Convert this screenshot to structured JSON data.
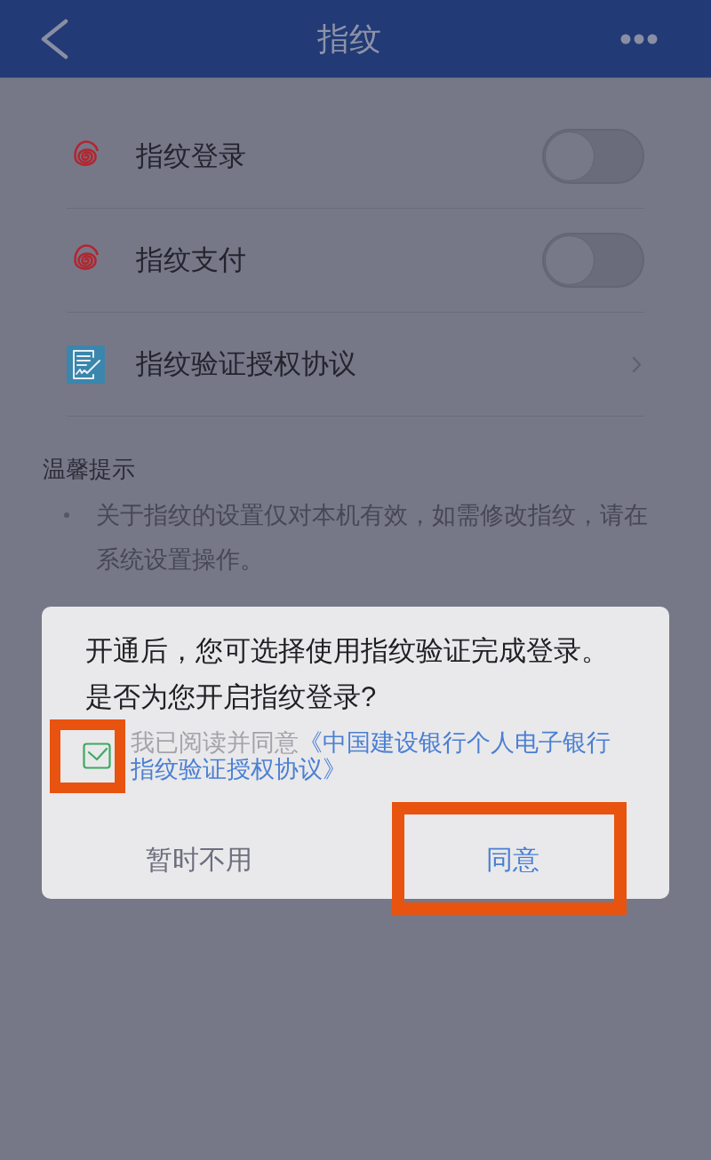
{
  "header": {
    "title": "指纹"
  },
  "settings": [
    {
      "kind": "toggle",
      "label": "指纹登录",
      "on": false
    },
    {
      "kind": "toggle",
      "label": "指纹支付",
      "on": false
    },
    {
      "kind": "link",
      "label": "指纹验证授权协议"
    }
  ],
  "tips": {
    "title": "温馨提示",
    "items": [
      "关于指纹的设置仅对本机有效，如需修改指纹，请在系统设置操作。"
    ]
  },
  "dialog": {
    "message": "开通后，您可选择使用指纹验证完成登录。是否为您开启指纹登录?",
    "agreement": {
      "checked": true,
      "highlighted": true,
      "text": "我已阅读并同意",
      "link": "《中国建设银行个人电子银行指纹验证授权协议》"
    },
    "buttons": [
      {
        "label": "暂时不用",
        "kind": "secondary",
        "highlighted": false
      },
      {
        "label": "同意",
        "kind": "primary",
        "highlighted": true
      }
    ]
  }
}
